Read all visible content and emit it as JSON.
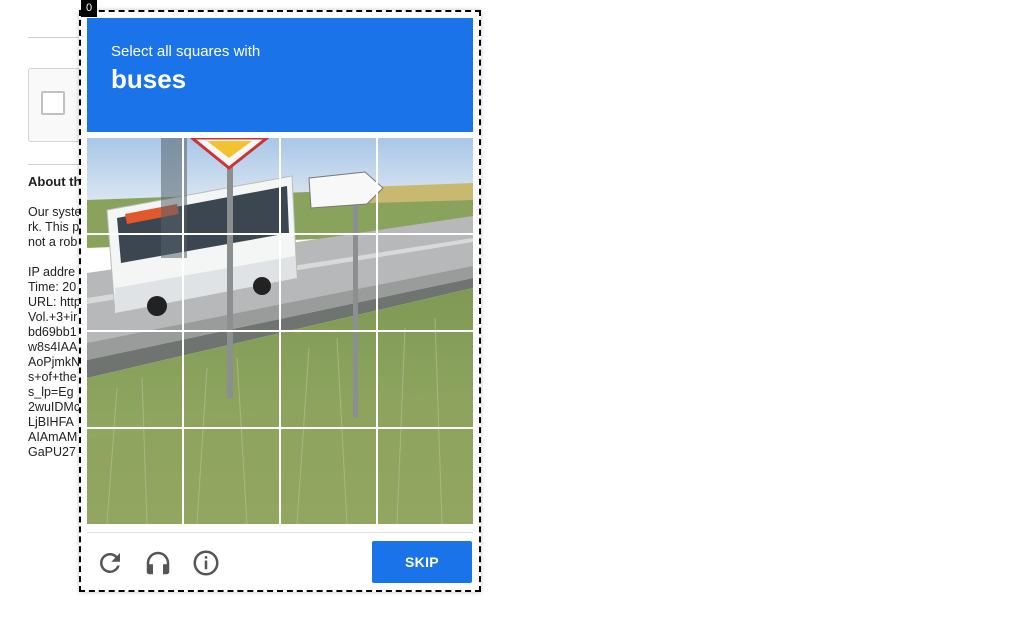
{
  "background_page": {
    "about_heading": "About th",
    "lines_block1": [
      "Our syste",
      "rk. This p",
      "not a rob"
    ],
    "lines_block2": [
      "IP addre",
      "Time: 20",
      "URL: http",
      "Vol.+3+ir",
      "bd69bb1",
      "w8s4IAA",
      "AoPjmkN",
      "s+of+the",
      "s_lp=Eg",
      "2wuIDMc",
      "LjBIHFA",
      "AIAmAM",
      "GaPU27"
    ]
  },
  "challenge": {
    "frame_index": "0",
    "instruction": "Select all squares with",
    "target": "buses",
    "grid_rows": 4,
    "grid_cols": 4,
    "skip_label": "SKIP",
    "colors": {
      "accent": "#1a73e8",
      "icon": "#555555"
    },
    "icons": [
      "reload-icon",
      "audio-headphones-icon",
      "info-icon"
    ]
  }
}
